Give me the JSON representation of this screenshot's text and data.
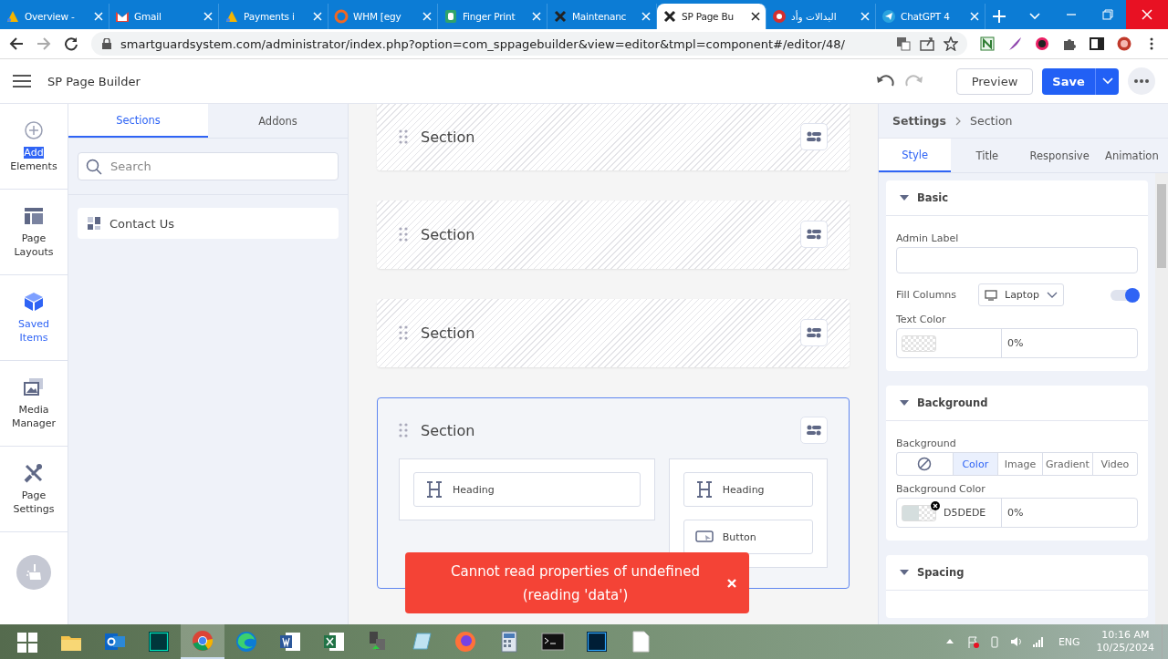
{
  "browser": {
    "tabs": [
      {
        "title": "Overview -",
        "selected": false
      },
      {
        "title": "Gmail",
        "selected": false
      },
      {
        "title": "Payments i",
        "selected": false
      },
      {
        "title": "WHM [egy",
        "selected": false
      },
      {
        "title": "Finger Print",
        "selected": false
      },
      {
        "title": "Maintenanc",
        "selected": false
      },
      {
        "title": "SP Page Bu",
        "selected": true
      },
      {
        "title": "البدالات وأد",
        "selected": false
      },
      {
        "title": "ChatGPT 4",
        "selected": false
      }
    ],
    "url": "smartguardsystem.com/administrator/index.php?option=com_sppagebuilder&view=editor&tmpl=component#/editor/48/"
  },
  "app": {
    "title": "SP Page Builder",
    "preview": "Preview",
    "save": "Save"
  },
  "rail": [
    {
      "selected": false,
      "label_parts": [
        {
          "text": "Add",
          "highlighted": true
        },
        {
          "text": "Elements",
          "highlighted": false
        }
      ]
    },
    {
      "selected": false,
      "label_parts": [
        {
          "text": "Page",
          "highlighted": false
        },
        {
          "text": "Layouts",
          "highlighted": false
        }
      ]
    },
    {
      "selected": true,
      "label_parts": [
        {
          "text": "Saved",
          "highlighted": false
        },
        {
          "text": "Items",
          "highlighted": false
        }
      ]
    },
    {
      "selected": false,
      "label_parts": [
        {
          "text": "Media",
          "highlighted": false
        },
        {
          "text": "Manager",
          "highlighted": false
        }
      ]
    },
    {
      "selected": false,
      "label_parts": [
        {
          "text": "Page",
          "highlighted": false
        },
        {
          "text": "Settings",
          "highlighted": false
        }
      ]
    }
  ],
  "panel": {
    "tabs": [
      {
        "label": "Sections",
        "selected": true
      },
      {
        "label": "Addons",
        "selected": false
      }
    ],
    "search": {
      "placeholder": "Search"
    },
    "items": [
      "Contact Us"
    ]
  },
  "canvas": {
    "sections": [
      {
        "title": "Section",
        "selected": false
      },
      {
        "title": "Section",
        "selected": false
      },
      {
        "title": "Section",
        "selected": false
      },
      {
        "title": "Section",
        "selected": true,
        "columns": [
          {
            "addons": [
              {
                "kind": "heading",
                "label": "Heading"
              }
            ]
          },
          {
            "addons": [
              {
                "kind": "heading",
                "label": "Heading"
              },
              {
                "kind": "button",
                "label": "Button"
              }
            ]
          }
        ]
      }
    ]
  },
  "settings": {
    "breadcrumb": [
      "Settings",
      "Section"
    ],
    "tabs": [
      {
        "label": "Style",
        "selected": true
      },
      {
        "label": "Title",
        "selected": false
      },
      {
        "label": "Responsive",
        "selected": false
      },
      {
        "label": "Animation",
        "selected": false
      }
    ],
    "groups": [
      {
        "title": "Basic",
        "expanded": true,
        "fields": [
          {
            "kind": "text",
            "label": "Admin Label"
          },
          {
            "kind": "device",
            "label": "Fill Columns",
            "device": "Laptop",
            "on": true
          },
          {
            "kind": "color",
            "label": "Text Color",
            "percent": "0%"
          }
        ]
      },
      {
        "title": "Background",
        "expanded": true,
        "fields": [
          {
            "kind": "segmented",
            "label": "Background",
            "options": [
              {
                "kind": "none",
                "selected": false
              },
              {
                "label": "Color",
                "selected": true
              },
              {
                "label": "Image",
                "selected": false
              },
              {
                "label": "Gradient",
                "selected": false
              },
              {
                "label": "Video",
                "selected": false
              }
            ]
          },
          {
            "kind": "color",
            "label": "Background Color",
            "value": "D5DEDE",
            "color": "#d5dede",
            "percent": "0%"
          }
        ]
      },
      {
        "title": "Spacing",
        "expanded": true
      }
    ]
  },
  "toast": {
    "message": "Cannot read properties of undefined (reading 'data')"
  },
  "taskbar": {
    "language": "ENG",
    "time": "10:16 AM",
    "date": "10/25/2024"
  }
}
